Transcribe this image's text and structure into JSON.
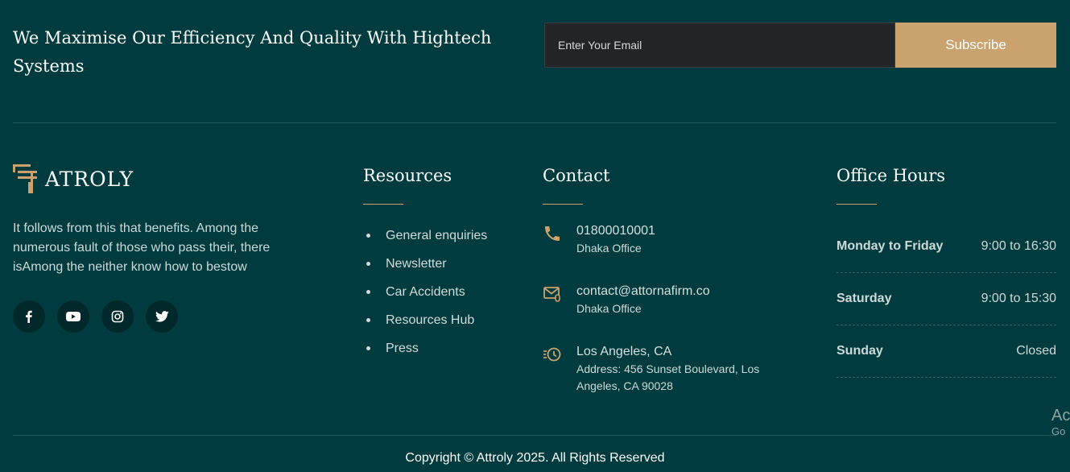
{
  "newsletter": {
    "title": "We Maximise Our Efficiency And Quality With Hightech Systems",
    "email_placeholder": "Enter Your Email",
    "subscribe_label": "Subscribe"
  },
  "brand": {
    "name": "ATROLY",
    "logo_icon": "pillar-logo-icon",
    "description": "It follows from this that benefits. Among the numerous fault of those who pass their, there isAmong the neither know how to bestow",
    "socials": [
      {
        "icon": "facebook-icon"
      },
      {
        "icon": "youtube-icon"
      },
      {
        "icon": "instagram-icon"
      },
      {
        "icon": "twitter-icon"
      }
    ]
  },
  "resources": {
    "title": "Resources",
    "items": [
      "General enquiries",
      "Newsletter",
      "Car Accidents",
      "Resources Hub",
      "Press"
    ]
  },
  "contact": {
    "title": "Contact",
    "items": [
      {
        "icon": "phone-icon",
        "main": "01800010001",
        "sub": "Dhaka Office"
      },
      {
        "icon": "mail-icon",
        "main": "contact@attornafirm.co",
        "sub": "Dhaka Office"
      },
      {
        "icon": "clock-history-icon",
        "main": "Los Angeles, CA",
        "sub": "Address: 456 Sunset Boulevard, Los Angeles, CA 90028"
      }
    ]
  },
  "office_hours": {
    "title": "Office Hours",
    "rows": [
      {
        "day": "Monday to Friday",
        "time": "9:00 to 16:30"
      },
      {
        "day": "Saturday",
        "time": "9:00 to 15:30"
      },
      {
        "day": "Sunday",
        "time": "Closed"
      }
    ]
  },
  "footer": {
    "copyright": "Copyright © Attroly 2025. All Rights Reserved"
  },
  "watermark": {
    "line1": "Ac",
    "line2": "Go"
  },
  "colors": {
    "background": "#003c3f",
    "accent": "#c9a26d",
    "input_bg": "#232428",
    "social_bg": "#01292b"
  }
}
